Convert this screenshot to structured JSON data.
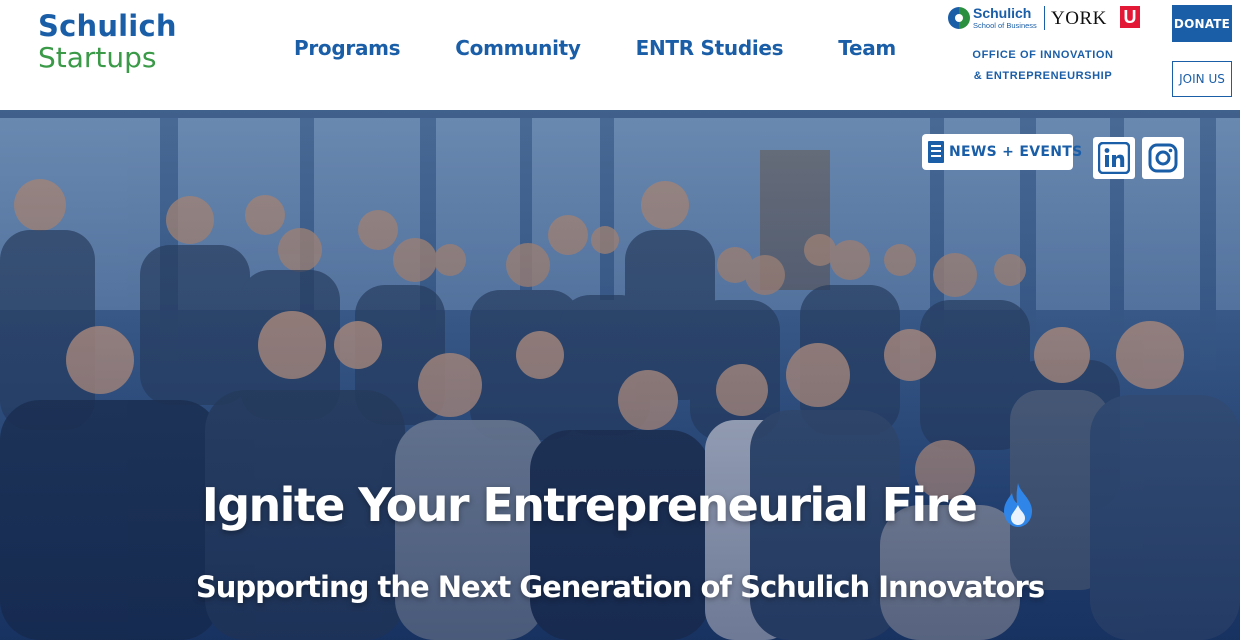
{
  "logo": {
    "line1": "Schulich",
    "line2": "Startups"
  },
  "nav": {
    "items": [
      {
        "label": "Programs"
      },
      {
        "label": "Community"
      },
      {
        "label": "ENTR Studies"
      },
      {
        "label": "Team"
      }
    ]
  },
  "partners": {
    "schulich_name": "Schulich",
    "schulich_sub": "School of Business",
    "york_name": "YORK",
    "york_mark": "U"
  },
  "office": {
    "line1": "OFFICE OF INNOVATION",
    "line2": "& ENTREPRENEURSHIP"
  },
  "header_actions": {
    "donate": "DONATE",
    "join": "JOIN US"
  },
  "hero": {
    "news_button": "NEWS + EVENTS",
    "social": [
      {
        "icon": "linkedin-icon"
      },
      {
        "icon": "instagram-icon"
      }
    ],
    "title": "Ignite Your Entrepreneurial Fire",
    "title_icon": "flame-icon",
    "subtitle": "Supporting the Next Generation of Schulich Innovators",
    "photo": "group photo of entrepreneurs posing indoors"
  },
  "colors": {
    "brand_blue": "#1b5ea8",
    "brand_green": "#3a9a48",
    "york_red": "#e31837",
    "flame_blue": "#2f86e8"
  }
}
